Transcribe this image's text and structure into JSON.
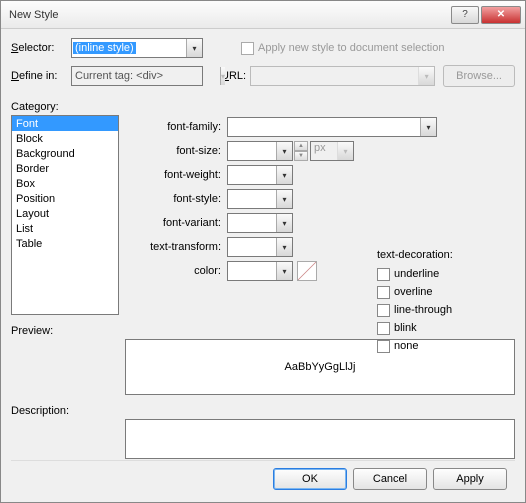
{
  "window": {
    "title": "New Style"
  },
  "selector": {
    "label": "Selector:",
    "value": "(inline style)"
  },
  "definein": {
    "label": "Define in:",
    "value": "Current tag: <div>"
  },
  "applychk": {
    "label": "Apply new style to document selection"
  },
  "url": {
    "label": "URL:"
  },
  "browse": {
    "label": "Browse..."
  },
  "category": {
    "label": "Category:",
    "items": [
      "Font",
      "Block",
      "Background",
      "Border",
      "Box",
      "Position",
      "Layout",
      "List",
      "Table"
    ],
    "selected": "Font"
  },
  "props": {
    "font_family": "font-family:",
    "font_size": "font-size:",
    "font_weight": "font-weight:",
    "font_style": "font-style:",
    "font_variant": "font-variant:",
    "text_transform": "text-transform:",
    "color": "color:",
    "size_unit": "px"
  },
  "decor": {
    "title": "text-decoration:",
    "underline": "underline",
    "overline": "overline",
    "linethrough": "line-through",
    "blink": "blink",
    "none": "none"
  },
  "preview": {
    "label": "Preview:",
    "sample": "AaBbYyGgLlJj"
  },
  "description": {
    "label": "Description:"
  },
  "buttons": {
    "ok": "OK",
    "cancel": "Cancel",
    "apply": "Apply"
  }
}
